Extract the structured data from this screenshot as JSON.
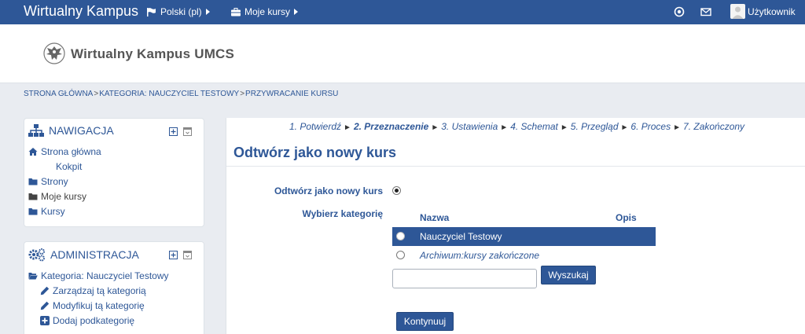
{
  "navbar": {
    "brand": "Wirtualny Kampus",
    "language": "Polski (pl)",
    "my_courses": "Moje kursy",
    "user": "Użytkownik"
  },
  "header": {
    "site_name": "Wirtualny Kampus UMCS"
  },
  "breadcrumb": {
    "items": [
      "STRONA GŁÓWNA",
      "KATEGORIA: NAUCZYCIEL TESTOWY",
      "PRZYWRACANIE KURSU"
    ],
    "separator": ">"
  },
  "navigation": {
    "title": "NAWIGACJA",
    "items": [
      "Strona główna",
      "Kokpit",
      "Strony",
      "Moje kursy",
      "Kursy"
    ]
  },
  "administration": {
    "title": "ADMINISTRACJA",
    "items": [
      "Kategoria: Nauczyciel Testowy",
      "Zarządzaj tą kategorią",
      "Modyfikuj tą kategorię",
      "Dodaj podkategorię"
    ]
  },
  "steps": {
    "items": [
      "1. Potwierdź",
      "2. Przeznaczenie",
      "3. Ustawienia",
      "4. Schemat",
      "5. Przegląd",
      "6. Proces",
      "7. Zakończony"
    ],
    "active_index": 1
  },
  "main": {
    "title": "Odtwórz jako nowy kurs",
    "restore_label": "Odtwórz jako nowy kurs",
    "category_label": "Wybierz kategorię",
    "col_name": "Nazwa",
    "col_desc": "Opis",
    "categories": [
      "Nauczyciel Testowy",
      "Archiwum:kursy zakończone"
    ],
    "search_value": "",
    "search_button": "Wyszukaj",
    "continue_button": "Kontynuuj"
  },
  "colors": {
    "primary": "#2e5797",
    "background": "#e9ecf1"
  }
}
